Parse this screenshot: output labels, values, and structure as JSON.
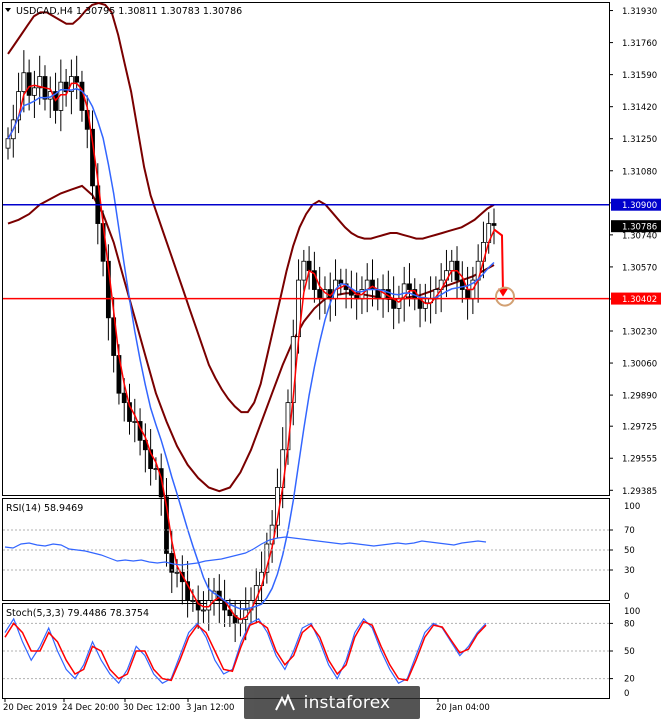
{
  "chart_data": [
    {
      "type": "candlestick",
      "title": "USDCAD,H4  1.30795 1.30811 1.30783 1.30786",
      "ylim": [
        1.2936,
        1.3197
      ],
      "y_ticks": [
        "1.31930",
        "1.31760",
        "1.31590",
        "1.31420",
        "1.31250",
        "1.31080",
        "1.30910",
        "1.30740",
        "1.30570",
        "1.30400",
        "1.30230",
        "1.30060",
        "1.29890",
        "1.29725",
        "1.29555",
        "1.29385"
      ],
      "x_ticks": [
        "20 Dec 2019",
        "24 Dec 20:00",
        "30 Dec 12:00",
        "3 Jan 12:00",
        "",
        "",
        "",
        "",
        "20 Jan 04:00"
      ],
      "horizontal_lines": [
        {
          "value": 1.309,
          "label": "1.30900",
          "color": "#0000cc"
        },
        {
          "value": 1.30402,
          "label": "1.30402",
          "color": "#ff0000"
        }
      ],
      "current_price": {
        "value": 1.30786,
        "label": "1.30786"
      },
      "close": [
        1.3125,
        1.3135,
        1.315,
        1.316,
        1.3148,
        1.3152,
        1.3158,
        1.3146,
        1.315,
        1.314,
        1.3155,
        1.315,
        1.3158,
        1.3155,
        1.314,
        1.313,
        1.31,
        1.308,
        1.306,
        1.303,
        1.301,
        1.299,
        1.2985,
        1.2975,
        1.2975,
        1.2965,
        1.296,
        1.295,
        1.295,
        1.2935,
        1.2905,
        1.2895,
        1.2895,
        1.289,
        1.288,
        1.288,
        1.2875,
        1.2875,
        1.288,
        1.2885,
        1.288,
        1.2875,
        1.2872,
        1.2868,
        1.287,
        1.2875,
        1.288,
        1.2888,
        1.2895,
        1.291,
        1.292,
        1.294,
        1.296,
        1.2985,
        1.302,
        1.305,
        1.306,
        1.3055,
        1.3045,
        1.304,
        1.3045,
        1.304,
        1.305,
        1.3048,
        1.3045,
        1.3042,
        1.304,
        1.3045,
        1.305,
        1.3045,
        1.304,
        1.3045,
        1.304,
        1.3035,
        1.304,
        1.3048,
        1.3045,
        1.304,
        1.3035,
        1.3038,
        1.304,
        1.3045,
        1.305,
        1.3055,
        1.306,
        1.305,
        1.3045,
        1.304,
        1.305,
        1.306,
        1.307,
        1.308,
        1.3079
      ],
      "upper_band": [
        1.317,
        1.3175,
        1.318,
        1.3185,
        1.319,
        1.3192,
        1.3192,
        1.319,
        1.3188,
        1.3186,
        1.3186,
        1.3189,
        1.3193,
        1.3196,
        1.3197,
        1.3196,
        1.3192,
        1.318,
        1.3165,
        1.315,
        1.313,
        1.311,
        1.3095,
        1.3085,
        1.3075,
        1.3065,
        1.3055,
        1.3045,
        1.3035,
        1.3025,
        1.3015,
        1.3005,
        1.2998,
        1.2992,
        1.2987,
        1.2983,
        1.298,
        1.298,
        1.2985,
        1.2995,
        1.301,
        1.3025,
        1.304,
        1.3055,
        1.3068,
        1.3078,
        1.3085,
        1.309,
        1.3092,
        1.309,
        1.3086,
        1.3082,
        1.3078,
        1.3075,
        1.3073,
        1.3072,
        1.3072,
        1.3073,
        1.3074,
        1.3075,
        1.3075,
        1.3074,
        1.3073,
        1.3072,
        1.3072,
        1.3073,
        1.3074,
        1.3075,
        1.3076,
        1.3077,
        1.3078,
        1.308,
        1.3082,
        1.3085,
        1.3088,
        1.309
      ],
      "lower_band": [
        1.308,
        1.3082,
        1.3085,
        1.309,
        1.3093,
        1.3096,
        1.3098,
        1.31,
        1.3095,
        1.3085,
        1.307,
        1.305,
        1.303,
        1.301,
        1.299,
        1.2975,
        1.2962,
        1.2952,
        1.2945,
        1.294,
        1.2938,
        1.294,
        1.2948,
        1.296,
        1.2975,
        1.299,
        1.3005,
        1.3018,
        1.3028,
        1.3035,
        1.304,
        1.3042,
        1.3043,
        1.3043,
        1.3042,
        1.3041,
        1.304,
        1.304,
        1.3041,
        1.3042,
        1.3044,
        1.3046,
        1.3048,
        1.305,
        1.3052,
        1.3055,
        1.3058
      ]
    },
    {
      "type": "line",
      "title": "RSI(14) 58.9469",
      "ylim": [
        0,
        100
      ],
      "y_ticks": [
        "70",
        "50",
        "30"
      ],
      "y_top_label": "100",
      "y_bottom_label": "0",
      "levels": [
        70,
        50,
        30
      ],
      "values": [
        53,
        52,
        56,
        57,
        55,
        54,
        56,
        55,
        51,
        50,
        49,
        47,
        45,
        42,
        39,
        40,
        39,
        40,
        38,
        37,
        38,
        36,
        35,
        36,
        37,
        39,
        40,
        41,
        43,
        45,
        47,
        51,
        56,
        60,
        62,
        63,
        62,
        61,
        60,
        59,
        58,
        57,
        56,
        57,
        56,
        55,
        54,
        55,
        56,
        57,
        56,
        57,
        59,
        58,
        57,
        56,
        55,
        57,
        58,
        59,
        58
      ]
    },
    {
      "type": "line",
      "title": "Stoch(5,3,3) 79.4486 78.3754",
      "ylim": [
        0,
        100
      ],
      "y_ticks": [
        "80",
        "50",
        "20"
      ],
      "y_top_label": "100",
      "y_bottom_label": "0",
      "levels": [
        80,
        50,
        20
      ],
      "series": [
        {
          "values": [
            70,
            85,
            60,
            40,
            55,
            75,
            50,
            30,
            20,
            35,
            60,
            40,
            25,
            15,
            30,
            55,
            45,
            25,
            15,
            20,
            45,
            70,
            80,
            65,
            40,
            25,
            30,
            60,
            80,
            85,
            70,
            45,
            30,
            50,
            75,
            80,
            60,
            35,
            20,
            40,
            70,
            85,
            75,
            50,
            30,
            15,
            20,
            45,
            70,
            80,
            75,
            60,
            45,
            55,
            70,
            80
          ]
        },
        {
          "values": [
            65,
            80,
            70,
            50,
            50,
            70,
            60,
            40,
            25,
            30,
            55,
            50,
            30,
            20,
            25,
            50,
            50,
            30,
            20,
            18,
            40,
            65,
            78,
            70,
            50,
            30,
            28,
            55,
            78,
            82,
            75,
            50,
            35,
            45,
            70,
            78,
            65,
            40,
            25,
            35,
            65,
            82,
            78,
            55,
            35,
            20,
            18,
            40,
            65,
            78,
            76,
            62,
            48,
            52,
            68,
            78
          ]
        }
      ]
    }
  ],
  "watermark": {
    "text": "instaforex"
  }
}
